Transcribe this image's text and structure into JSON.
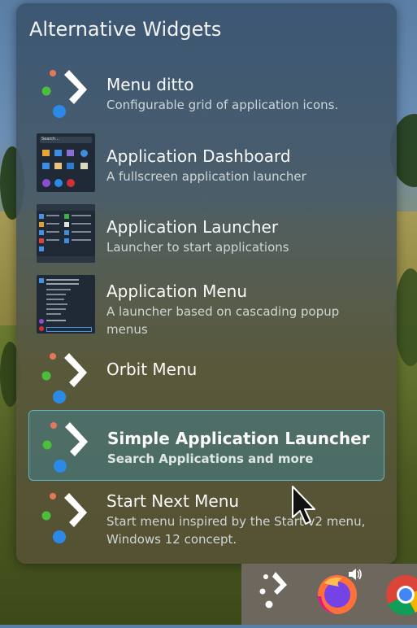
{
  "panel": {
    "title": "Alternative Widgets",
    "items": [
      {
        "title": "Menu ditto",
        "desc": "Configurable grid of application icons.",
        "icon": "kickoff-logo-icon"
      },
      {
        "title": "Application Dashboard",
        "desc": "A fullscreen application launcher",
        "icon": "dashboard-thumbnail"
      },
      {
        "title": "Application Launcher",
        "desc": "Launcher to start applications",
        "icon": "launcher-thumbnail"
      },
      {
        "title": "Application Menu",
        "desc": "A launcher based on cascading popup menus",
        "icon": "menu-thumbnail"
      },
      {
        "title": "Orbit Menu",
        "desc": "",
        "icon": "kickoff-logo-icon"
      },
      {
        "title": "Simple Application Launcher",
        "desc": "Search Applications and more",
        "icon": "kickoff-logo-icon",
        "selected": true
      },
      {
        "title": "Start Next Menu",
        "desc": "Start menu inspired by the Start v2 menu, Windows 12 concept.",
        "icon": "kickoff-logo-icon"
      }
    ]
  },
  "thumbs": {
    "search_placeholder": "Search..."
  },
  "taskbar": {
    "items": [
      "app-launcher",
      "firefox",
      "chrome"
    ]
  },
  "colors": {
    "accent": "#5fb5c8",
    "selected_bg": "#46828c",
    "dot_orange": "#e8775a",
    "dot_green": "#4cbf3a",
    "dot_blue": "#2b8ae8"
  }
}
